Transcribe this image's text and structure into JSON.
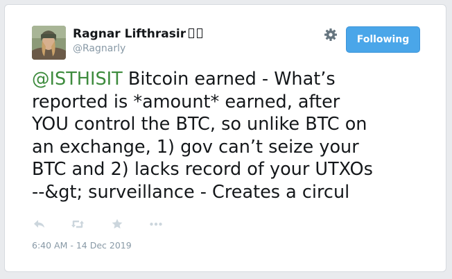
{
  "author": {
    "display_name": "Ragnar Lifthrasir",
    "handle": "@Ragnarly",
    "avatar_icon": "profile-photo"
  },
  "header": {
    "settings_icon": "gear-icon",
    "follow_button_label": "Following"
  },
  "tweet": {
    "mention": "@ISTHISIT",
    "lines": [
      " Bitcoin earned - What’s",
      "reported is *amount* earned, after",
      "YOU control the BTC, so unlike BTC on",
      "an exchange, 1) gov can’t seize your",
      "BTC and 2) lacks record of your UTXOs",
      "--&gt; surveillance - Creates a circul"
    ]
  },
  "actions": [
    "reply-icon",
    "retweet-icon",
    "like-icon",
    "more-icon"
  ],
  "timestamp": "6:40 AM - 14 Dec 2019",
  "colors": {
    "mention": "#3d8b3d",
    "button": "#4aa6e9",
    "muted": "#8899a6",
    "text": "#14171a"
  }
}
